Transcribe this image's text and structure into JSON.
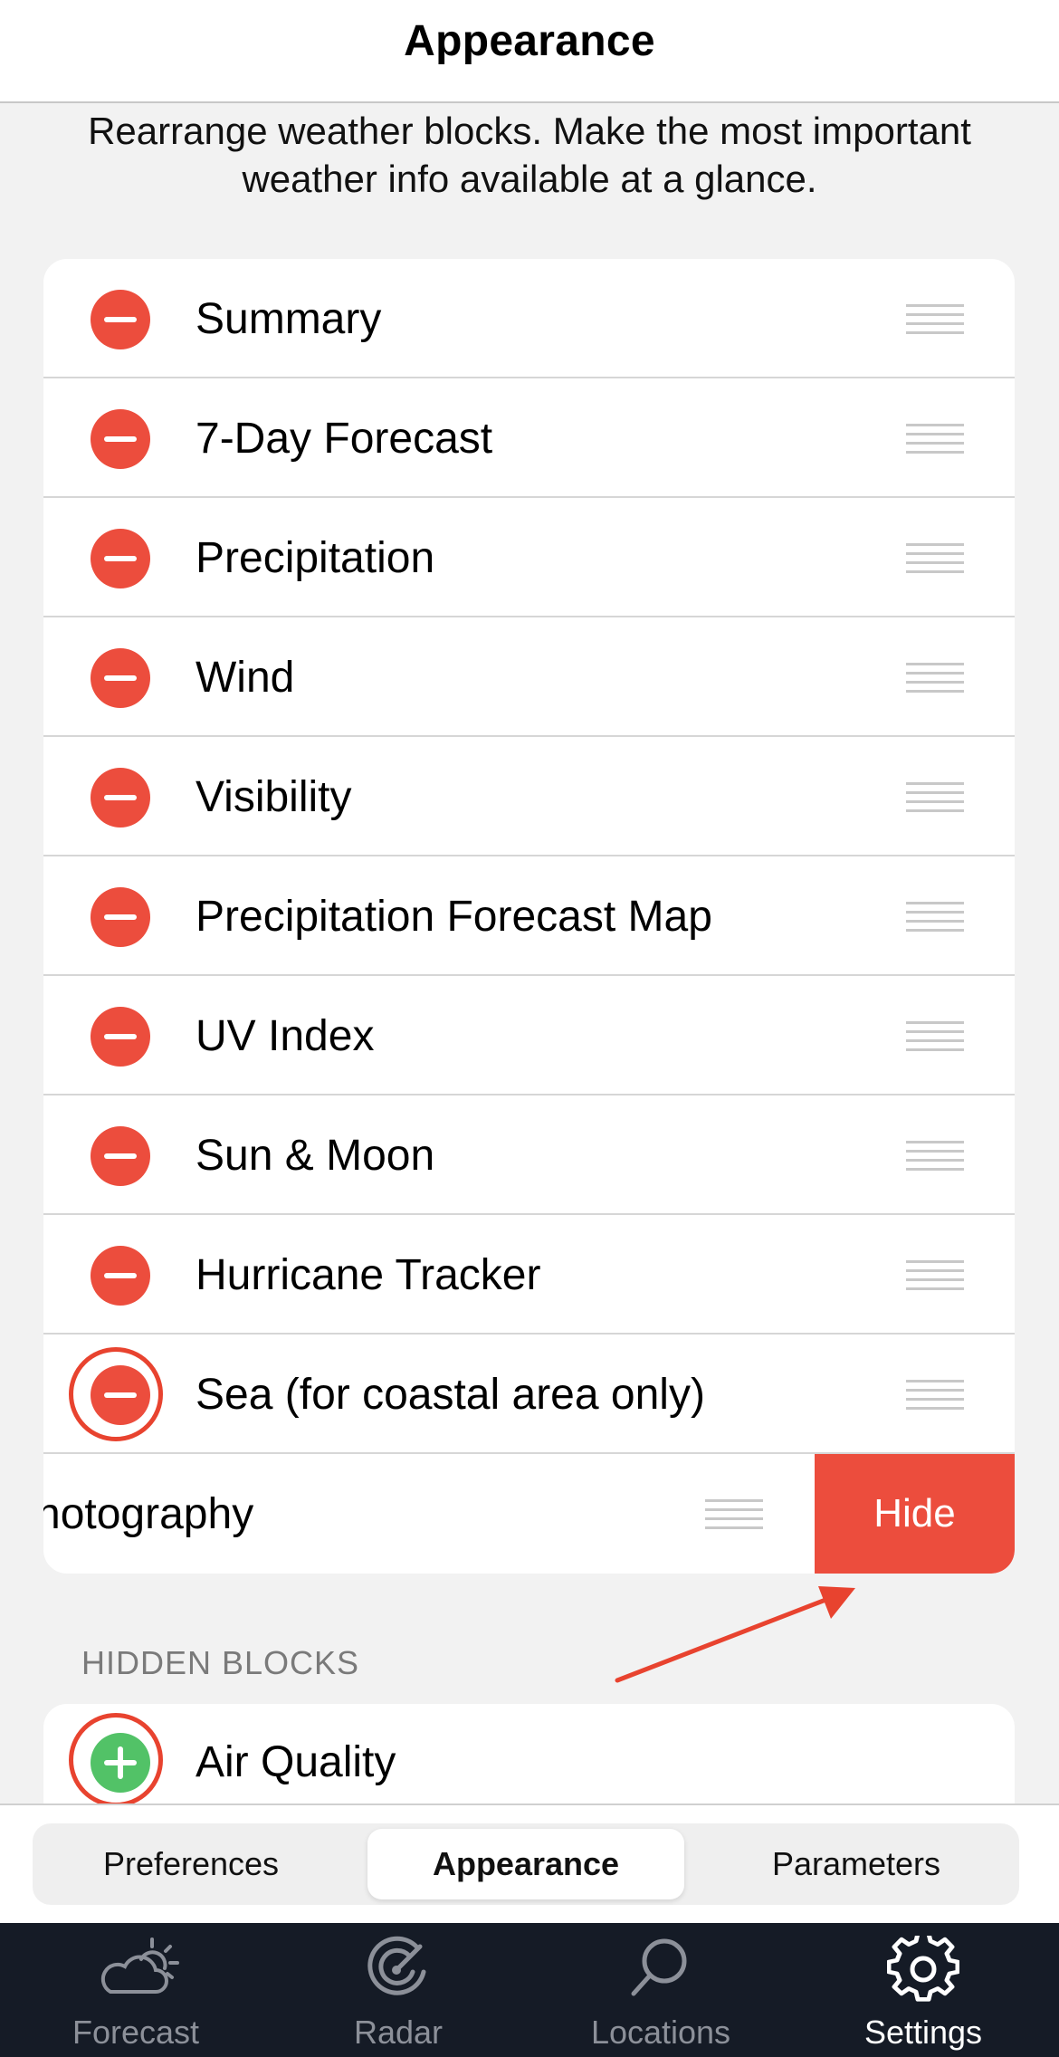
{
  "header": {
    "title": "Appearance"
  },
  "description": "Rearrange weather blocks. Make the most important weather info available at a glance.",
  "visible_blocks": [
    {
      "label": "Summary"
    },
    {
      "label": "7-Day Forecast"
    },
    {
      "label": "Precipitation"
    },
    {
      "label": "Wind"
    },
    {
      "label": "Visibility"
    },
    {
      "label": "Precipitation Forecast Map"
    },
    {
      "label": "UV Index"
    },
    {
      "label": "Sun & Moon"
    },
    {
      "label": "Hurricane Tracker"
    },
    {
      "label": "Sea (for coastal area only)"
    }
  ],
  "swiped_block": {
    "label": "hotography",
    "action_label": "Hide"
  },
  "hidden_section": {
    "header": "HIDDEN BLOCKS",
    "items": [
      {
        "label": "Air Quality"
      }
    ]
  },
  "segments": [
    {
      "label": "Preferences",
      "active": false
    },
    {
      "label": "Appearance",
      "active": true
    },
    {
      "label": "Parameters",
      "active": false
    }
  ],
  "tabbar": [
    {
      "label": "Forecast",
      "icon": "cloud-sun-icon",
      "active": false
    },
    {
      "label": "Radar",
      "icon": "radar-icon",
      "active": false
    },
    {
      "label": "Locations",
      "icon": "search-icon",
      "active": false
    },
    {
      "label": "Settings",
      "icon": "gear-icon",
      "active": true
    }
  ],
  "colors": {
    "remove": "#ec4d3d",
    "add": "#52c267",
    "annotation": "#e8432f",
    "tabbar_bg": "#151b26"
  }
}
